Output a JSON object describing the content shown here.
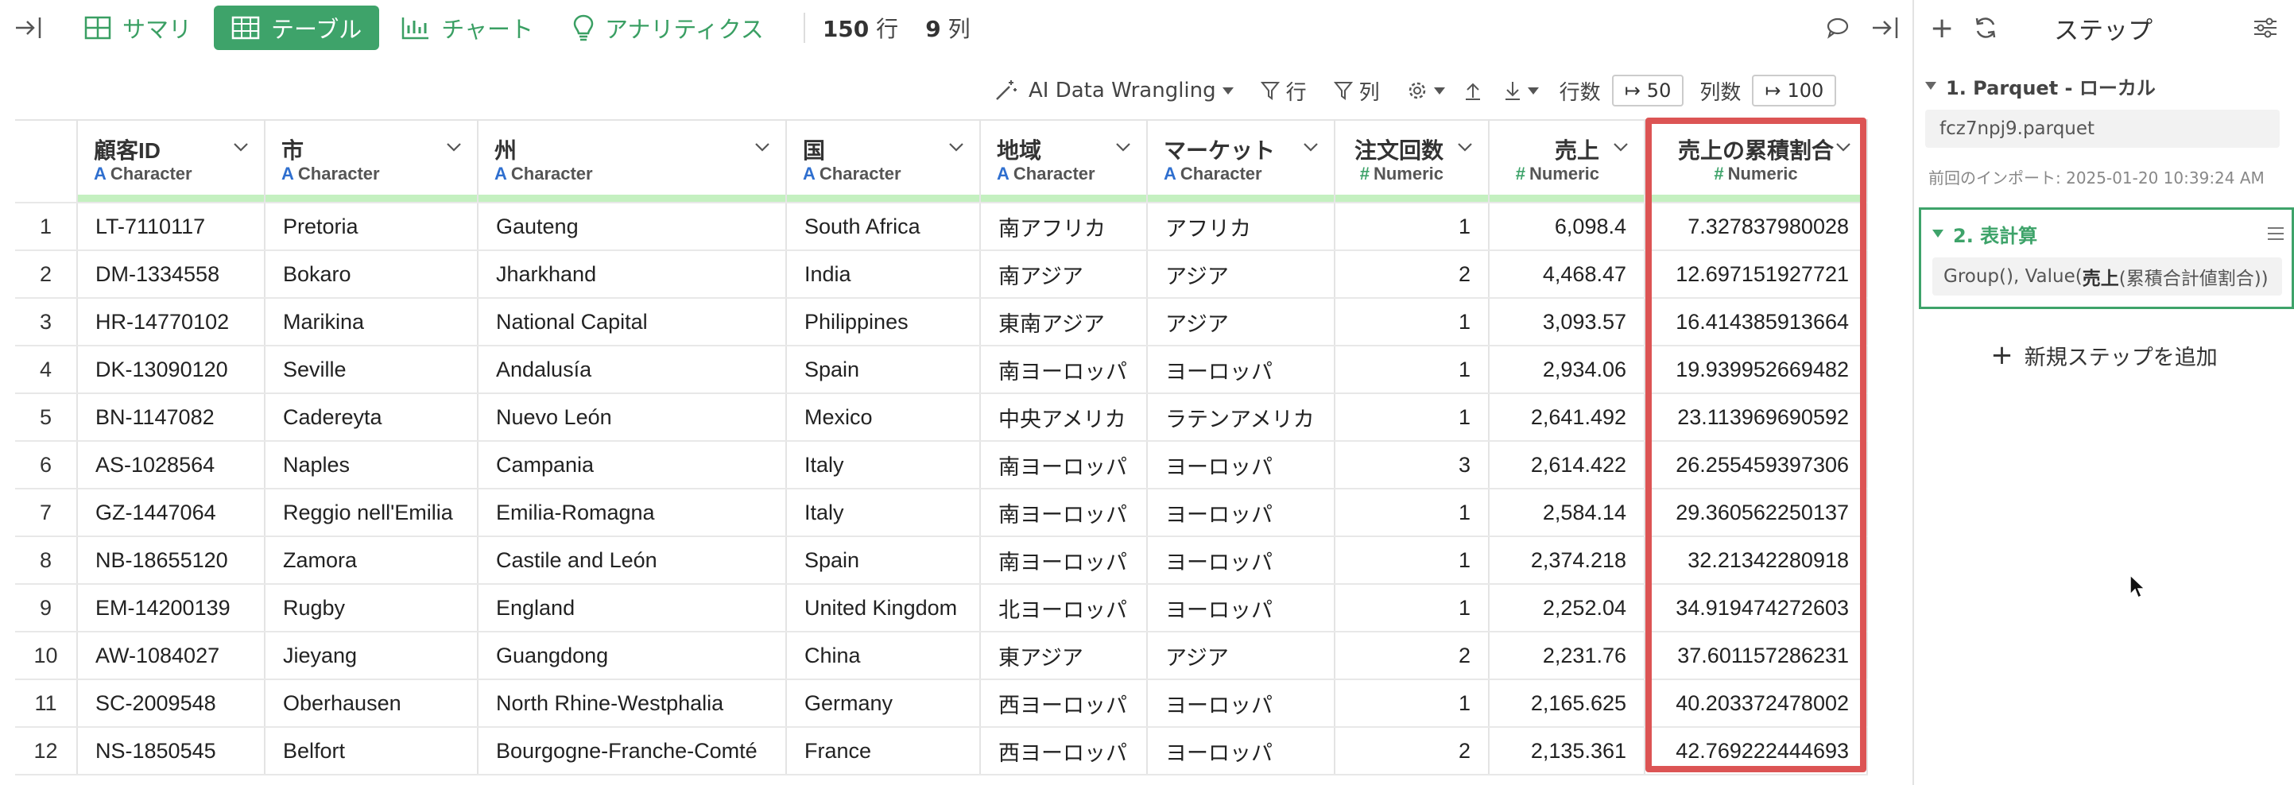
{
  "toolbar": {
    "tabs": [
      {
        "label": "サマリ",
        "icon": "summary-grid-icon"
      },
      {
        "label": "テーブル",
        "icon": "table-icon",
        "active": true
      },
      {
        "label": "チャート",
        "icon": "bar-chart-icon"
      },
      {
        "label": "アナリティクス",
        "icon": "lightbulb-icon"
      }
    ],
    "rows_count": "150",
    "rows_unit": "行",
    "cols_count": "9",
    "cols_unit": "列"
  },
  "subbar": {
    "wrangling_label": "AI Data Wrangling",
    "row_label": "行",
    "col_label": "列",
    "row_count_label": "行数",
    "row_count_value": "50",
    "col_count_label": "列数",
    "col_count_value": "100"
  },
  "columns": [
    {
      "name": "顧客ID",
      "type": "Character"
    },
    {
      "name": "市",
      "type": "Character"
    },
    {
      "name": "州",
      "type": "Character"
    },
    {
      "name": "国",
      "type": "Character"
    },
    {
      "name": "地域",
      "type": "Character"
    },
    {
      "name": "マーケット",
      "type": "Character"
    },
    {
      "name": "注文回数",
      "type": "Numeric"
    },
    {
      "name": "売上",
      "type": "Numeric"
    },
    {
      "name": "売上の累積割合",
      "type": "Numeric"
    }
  ],
  "rows": [
    [
      "1",
      "LT-7110117",
      "Pretoria",
      "Gauteng",
      "South Africa",
      "南アフリカ",
      "アフリカ",
      "1",
      "6,098.4",
      "7.327837980028"
    ],
    [
      "2",
      "DM-1334558",
      "Bokaro",
      "Jharkhand",
      "India",
      "南アジア",
      "アジア",
      "2",
      "4,468.47",
      "12.697151927721"
    ],
    [
      "3",
      "HR-14770102",
      "Marikina",
      "National Capital",
      "Philippines",
      "東南アジア",
      "アジア",
      "1",
      "3,093.57",
      "16.414385913664"
    ],
    [
      "4",
      "DK-13090120",
      "Seville",
      "Andalusía",
      "Spain",
      "南ヨーロッパ",
      "ヨーロッパ",
      "1",
      "2,934.06",
      "19.939952669482"
    ],
    [
      "5",
      "BN-1147082",
      "Cadereyta",
      "Nuevo León",
      "Mexico",
      "中央アメリカ",
      "ラテンアメリカ",
      "1",
      "2,641.492",
      "23.113969690592"
    ],
    [
      "6",
      "AS-1028564",
      "Naples",
      "Campania",
      "Italy",
      "南ヨーロッパ",
      "ヨーロッパ",
      "3",
      "2,614.422",
      "26.255459397306"
    ],
    [
      "7",
      "GZ-1447064",
      "Reggio nell'Emilia",
      "Emilia-Romagna",
      "Italy",
      "南ヨーロッパ",
      "ヨーロッパ",
      "1",
      "2,584.14",
      "29.360562250137"
    ],
    [
      "8",
      "NB-18655120",
      "Zamora",
      "Castile and León",
      "Spain",
      "南ヨーロッパ",
      "ヨーロッパ",
      "1",
      "2,374.218",
      "32.21342280918"
    ],
    [
      "9",
      "EM-14200139",
      "Rugby",
      "England",
      "United Kingdom",
      "北ヨーロッパ",
      "ヨーロッパ",
      "1",
      "2,252.04",
      "34.919474272603"
    ],
    [
      "10",
      "AW-1084027",
      "Jieyang",
      "Guangdong",
      "China",
      "東アジア",
      "アジア",
      "2",
      "2,231.76",
      "37.601157286231"
    ],
    [
      "11",
      "SC-2009548",
      "Oberhausen",
      "North Rhine-Westphalia",
      "Germany",
      "西ヨーロッパ",
      "ヨーロッパ",
      "1",
      "2,165.625",
      "40.203372478002"
    ],
    [
      "12",
      "NS-1850545",
      "Belfort",
      "Bourgogne-Franche-Comté",
      "France",
      "西ヨーロッパ",
      "ヨーロッパ",
      "2",
      "2,135.361",
      "42.769222444693"
    ]
  ],
  "panel": {
    "title": "ステップ",
    "step1_title": "1. Parquet - ローカル",
    "step1_file": "fcz7npj9.parquet",
    "step1_note": "前回のインポート: 2025-01-20 10:39:24 AM",
    "step2_title": "2. 表計算",
    "step2_detail_prefix": "Group(), Value(",
    "step2_detail_bold": "売上",
    "step2_detail_suffix": " (累積合計値割合))",
    "add_step": "新規ステップを追加"
  },
  "colors": {
    "accent_green": "#3ea36a",
    "highlight_red": "#dc5454",
    "type_char_blue": "#2f6fcf",
    "header_bar": "#c4f0c0"
  }
}
